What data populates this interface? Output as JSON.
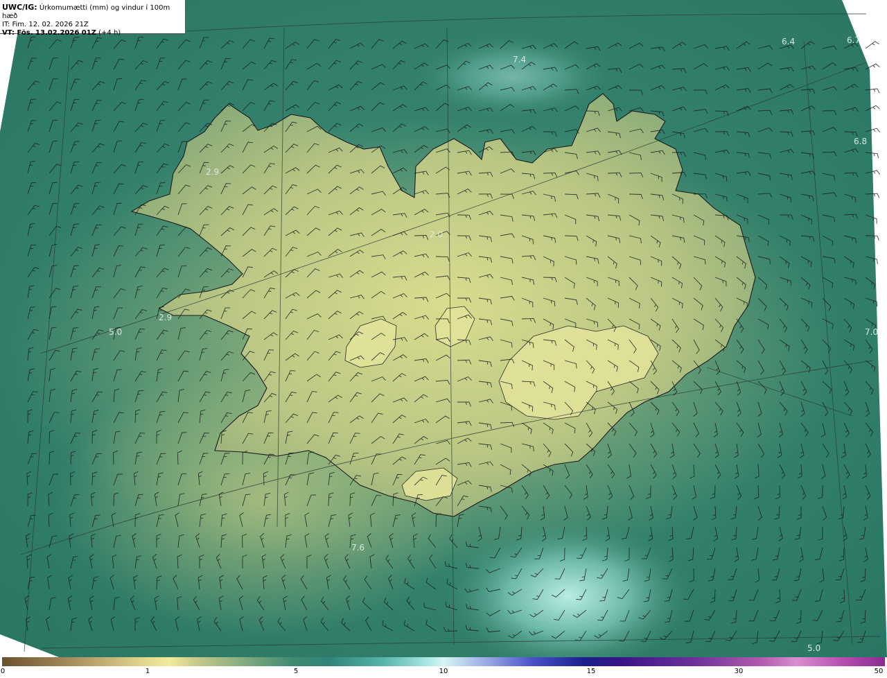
{
  "header": {
    "code": "UWC/IG:",
    "title": "Úrkomumætti (mm) og vindur í 100m hæð",
    "it": "IT: Fim. 12. 02. 2026 21Z",
    "vt_bold": "VT: Fös. 13.02.2026 01Z",
    "vt_suffix": "(+4 h)"
  },
  "value_labels": [
    "6.4",
    "6.7",
    "7.4",
    "6.8",
    "2.9",
    "2.0",
    "7.0",
    "2.9",
    "5.0",
    "7.6",
    "5.0"
  ],
  "colorbar": {
    "ticks": [
      "0",
      "1",
      "5",
      "10",
      "15",
      "30",
      "50"
    ]
  },
  "colors": {
    "ocean": "#2d7b68",
    "land_low": "#8fae72",
    "land_high": "#dfe28f",
    "glacier": "#e6e69a",
    "coastline": "#1a1a1a"
  }
}
